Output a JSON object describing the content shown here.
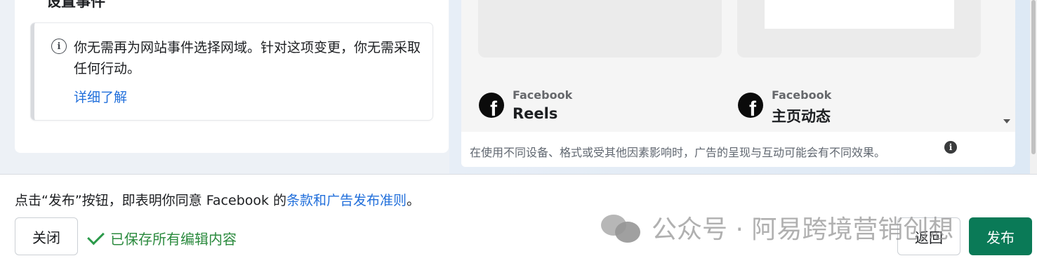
{
  "left_panel": {
    "cut_title": "设置事件",
    "notice": {
      "text": "你无需再为网站事件选择网域。针对这项变更，你无需采取任何行动。",
      "link": "详细了解"
    }
  },
  "preview": {
    "placements": [
      {
        "platform": "Facebook",
        "name": "Reels"
      },
      {
        "platform": "Facebook",
        "name": "主页动态"
      }
    ],
    "disclaimer": "在使用不同设备、格式或受其他因素影响时，广告的呈现与互动可能会有不同效果。"
  },
  "footer": {
    "terms_prefix": "点击“发布”按钮，即表明你同意 Facebook 的",
    "terms_link": "条款和广告发布准则",
    "terms_suffix": "。",
    "close_label": "关闭",
    "saved_status": "已保存所有编辑内容",
    "back_label": "返回",
    "publish_label": "发布"
  },
  "watermark": "公众号 · 阿易跨境营销创想",
  "colors": {
    "link": "#216fdb",
    "publish": "#0a7a57",
    "saved": "#2b8a3e"
  },
  "icons": {
    "info": "info-icon",
    "facebook": "facebook-logo-icon",
    "check": "check-icon"
  }
}
